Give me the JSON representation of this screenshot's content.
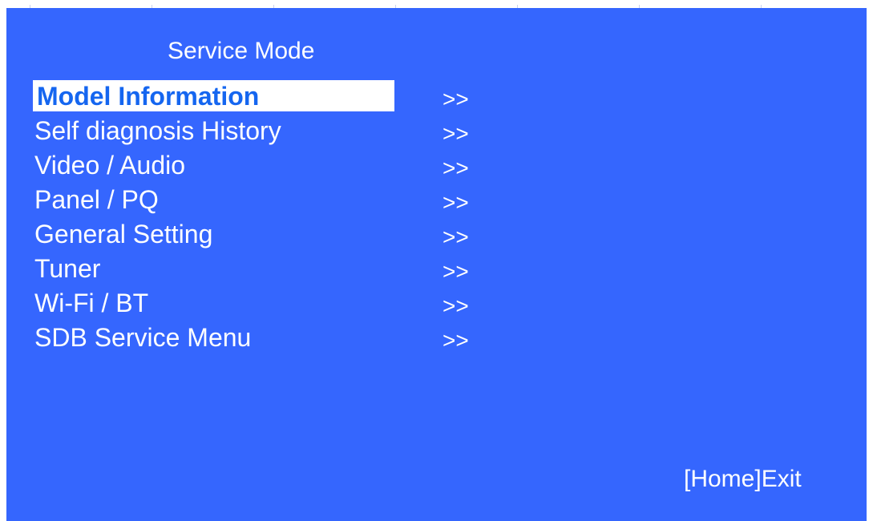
{
  "screen": {
    "title": "Service Mode",
    "exit_hint": "[Home]Exit",
    "selected_color": "#1566f0",
    "background_color": "#3566fe"
  },
  "menu": {
    "items": [
      {
        "label": "Model Information",
        "arrow": ">>",
        "selected": true
      },
      {
        "label": "Self diagnosis History",
        "arrow": ">>",
        "selected": false
      },
      {
        "label": "Video / Audio",
        "arrow": ">>",
        "selected": false
      },
      {
        "label": "Panel / PQ",
        "arrow": ">>",
        "selected": false
      },
      {
        "label": "General Setting",
        "arrow": ">>",
        "selected": false
      },
      {
        "label": "Tuner",
        "arrow": ">>",
        "selected": false
      },
      {
        "label": "Wi-Fi / BT",
        "arrow": ">>",
        "selected": false
      },
      {
        "label": "SDB Service Menu",
        "arrow": ">>",
        "selected": false
      }
    ]
  }
}
